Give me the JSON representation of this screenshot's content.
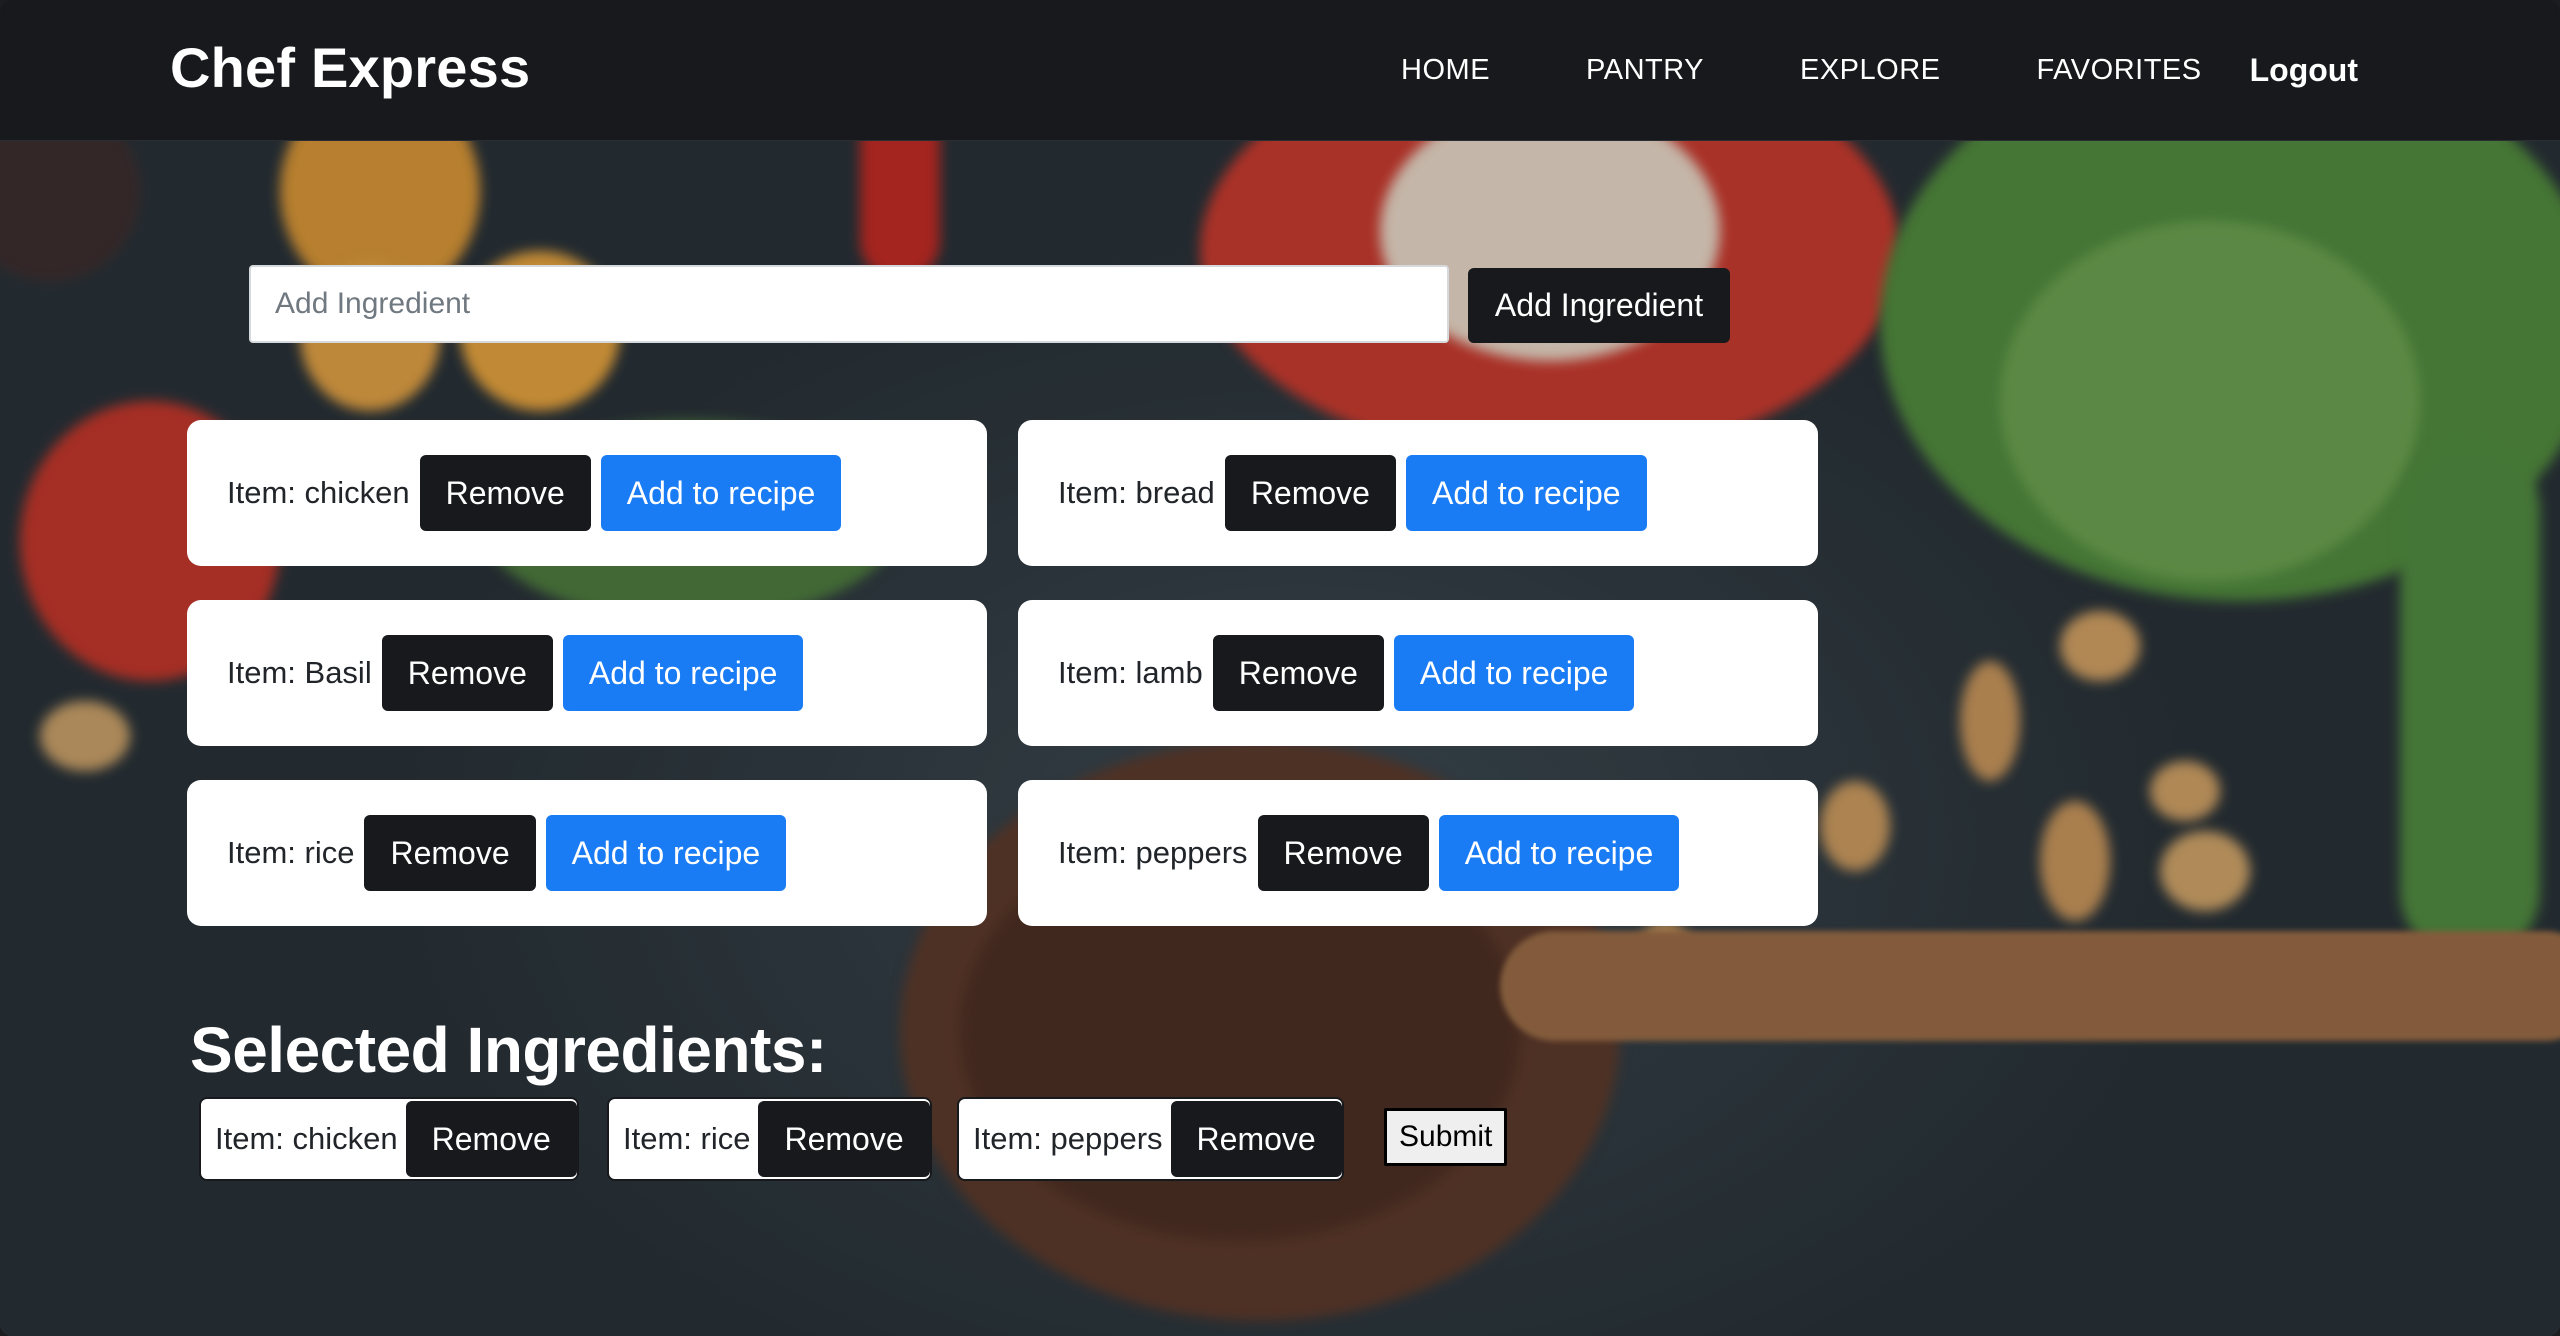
{
  "navbar": {
    "brand": "Chef Express",
    "links": [
      "HOME",
      "PANTRY",
      "EXPLORE",
      "FAVORITES"
    ],
    "logout": "Logout"
  },
  "add_ingredient": {
    "placeholder": "Add Ingredient",
    "value": "",
    "button_label": "Add Ingredient"
  },
  "pantry_items": [
    {
      "label": "Item: chicken",
      "remove_label": "Remove",
      "add_label": "Add to recipe"
    },
    {
      "label": "Item: bread",
      "remove_label": "Remove",
      "add_label": "Add to recipe"
    },
    {
      "label": "Item: Basil",
      "remove_label": "Remove",
      "add_label": "Add to recipe"
    },
    {
      "label": "Item: lamb",
      "remove_label": "Remove",
      "add_label": "Add to recipe"
    },
    {
      "label": "Item: rice",
      "remove_label": "Remove",
      "add_label": "Add to recipe"
    },
    {
      "label": "Item: peppers",
      "remove_label": "Remove",
      "add_label": "Add to recipe"
    }
  ],
  "selected": {
    "title": "Selected Ingredients:",
    "items": [
      {
        "label": "Item: chicken",
        "remove_label": "Remove"
      },
      {
        "label": "Item: rice",
        "remove_label": "Remove"
      },
      {
        "label": "Item: peppers",
        "remove_label": "Remove"
      }
    ],
    "submit_label": "Submit"
  },
  "colors": {
    "navbar_bg": "#17191c",
    "primary_blue": "#1a7cf5",
    "dark_button": "#17191c"
  }
}
